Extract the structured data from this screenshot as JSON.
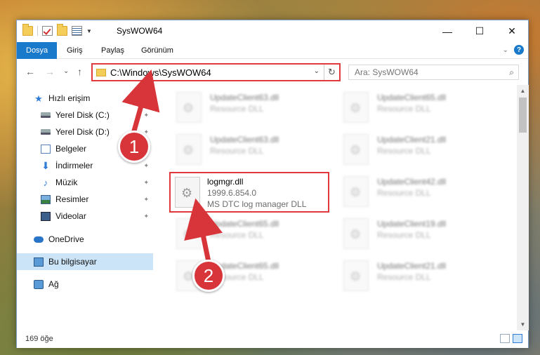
{
  "window": {
    "title": "SysWOW64",
    "minimize_glyph": "—",
    "maximize_glyph": "☐",
    "close_glyph": "✕"
  },
  "ribbon": {
    "tabs": [
      "Dosya",
      "Giriş",
      "Paylaş",
      "Görünüm"
    ],
    "active_tab": "Dosya",
    "expand_glyph": "⌄",
    "help_glyph": "?"
  },
  "nav": {
    "back_glyph": "←",
    "forward_glyph": "→",
    "recent_glyph": "⌄",
    "up_glyph": "↑"
  },
  "address": {
    "path": "C:\\Windows\\SysWOW64",
    "dropdown_glyph": "⌄",
    "refresh_glyph": "↻"
  },
  "search": {
    "placeholder": "Ara: SysWOW64",
    "icon": "search-icon"
  },
  "sidebar": {
    "items": [
      {
        "label": "Hızlı erişim",
        "icon": "star-icon",
        "pinned": false
      },
      {
        "label": "Yerel Disk (C:)",
        "icon": "disk-icon",
        "pinned": true
      },
      {
        "label": "Yerel Disk (D:)",
        "icon": "disk-icon",
        "pinned": true
      },
      {
        "label": "Belgeler",
        "icon": "documents-icon",
        "pinned": true
      },
      {
        "label": "İndirmeler",
        "icon": "download-icon",
        "pinned": true
      },
      {
        "label": "Müzik",
        "icon": "music-icon",
        "pinned": true
      },
      {
        "label": "Resimler",
        "icon": "pictures-icon",
        "pinned": true
      },
      {
        "label": "Videolar",
        "icon": "videos-icon",
        "pinned": true
      },
      {
        "label": "OneDrive",
        "icon": "cloud-icon",
        "pinned": false
      },
      {
        "label": "Bu bilgisayar",
        "icon": "computer-icon",
        "pinned": false,
        "selected": true
      },
      {
        "label": "Ağ",
        "icon": "network-icon",
        "pinned": false
      }
    ],
    "pin_glyph": "📌"
  },
  "files": {
    "left_column": [
      {
        "name": "UpdateClient63.dll",
        "type": "Resource DLL"
      },
      {
        "name": "UpdateClient63.dll",
        "type": "Resource DLL"
      },
      {
        "name": "logmgr.dll",
        "version": "1999.6.854.0",
        "description": "MS DTC log manager DLL"
      },
      {
        "name": "UpdateClient65.dll",
        "type": "Resource DLL"
      },
      {
        "name": "UpdateClient65.dll",
        "type": "Resource DLL"
      }
    ],
    "right_column": [
      {
        "name": "UpdateClient65.dll",
        "type": "Resource DLL"
      },
      {
        "name": "UpdateClient21.dll",
        "type": "Resource DLL"
      },
      {
        "name": "UpdateClient42.dll",
        "type": "Resource DLL"
      },
      {
        "name": "UpdateClient19.dll",
        "type": "Resource DLL"
      },
      {
        "name": "UpdateClient21.dll",
        "type": "Resource DLL"
      }
    ]
  },
  "status": {
    "item_count": "169 öğe"
  },
  "annotations": {
    "badge_1": "1",
    "badge_2": "2",
    "color": "#d8353a"
  },
  "colors": {
    "accent": "#1979ca",
    "highlight_box": "#e03a3e",
    "selected_nav": "#cce4f7"
  }
}
